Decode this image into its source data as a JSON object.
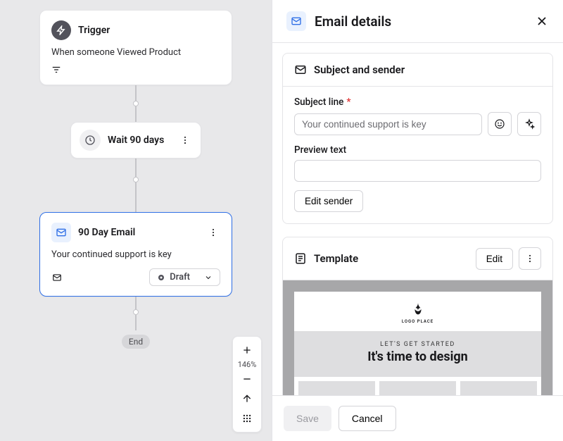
{
  "flow": {
    "trigger": {
      "title": "Trigger",
      "sub": "When someone Viewed Product"
    },
    "wait": {
      "label": "Wait 90 days"
    },
    "email": {
      "title": "90 Day Email",
      "sub": "Your continued support is key",
      "status": "Draft"
    },
    "end": "End"
  },
  "zoom": {
    "pct": "146%"
  },
  "panel": {
    "title": "Email details",
    "subject_card": {
      "title": "Subject and sender",
      "subject_label": "Subject line",
      "subject_value": "Your continued support is key",
      "preview_label": "Preview text",
      "preview_value": "",
      "edit_sender": "Edit sender"
    },
    "template_card": {
      "title": "Template",
      "edit": "Edit",
      "logo_text": "LOGO PLACE",
      "kicker": "LET'S GET STARTED",
      "headline": "It's time to design"
    },
    "save": "Save",
    "cancel": "Cancel"
  }
}
